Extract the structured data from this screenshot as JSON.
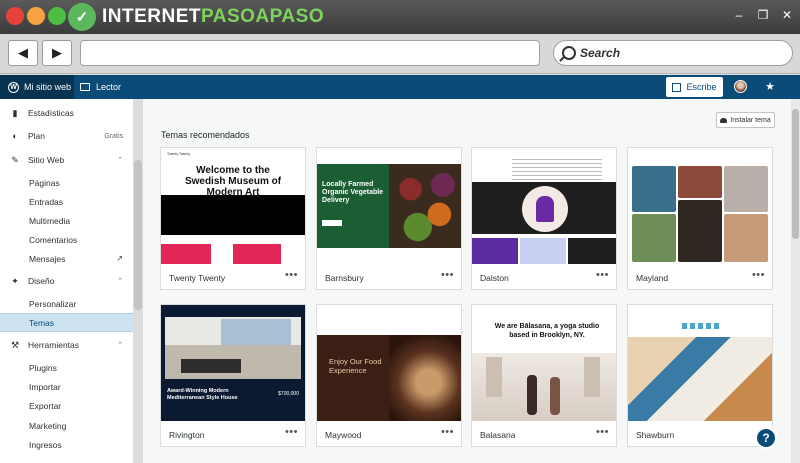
{
  "browser": {
    "logo_text_1": "INTERNET",
    "logo_text_2": "PASOAPASO",
    "search_placeholder": "Search"
  },
  "adminbar": {
    "site_label": "Mi sitio web",
    "reader_label": "Lector",
    "write_label": "Escribe"
  },
  "sidebar": {
    "stats": "Estadísticas",
    "plan": "Plan",
    "plan_badge": "Gratis",
    "site_web": "Sitio Web",
    "pages": "Páginas",
    "posts": "Entradas",
    "media": "Multimedia",
    "comments": "Comentarios",
    "messages": "Mensajes",
    "design": "Diseño",
    "customize": "Personalizar",
    "themes": "Temas",
    "tools": "Herramientas",
    "plugins": "Plugins",
    "import": "Importar",
    "export": "Exportar",
    "marketing": "Marketing",
    "earnings": "Ingresos"
  },
  "main": {
    "section_title": "Temas recomendados",
    "install_label": "Instalar tema",
    "more_label": "•••",
    "themes": [
      {
        "name": "Twenty Twenty",
        "headline": "Welcome to the Swedish Museum of Modern Art"
      },
      {
        "name": "Barnsbury",
        "headline": "Locally Farmed Organic Vegetable Delivery"
      },
      {
        "name": "Dalston"
      },
      {
        "name": "Mayland"
      },
      {
        "name": "Rivington",
        "headline": "Award-Winning Modern Mediterranean Style House",
        "price": "$700,000"
      },
      {
        "name": "Maywood",
        "headline": "Enjoy Our Food Experience"
      },
      {
        "name": "Balasana",
        "headline": "We are Bālasana, a yoga studio based in Brooklyn, NY."
      },
      {
        "name": "Shawburn"
      }
    ]
  },
  "colors": {
    "admin_bar": "#0a4b78",
    "active_item_bg": "#cde3f1",
    "accent_pink": "#e22658"
  }
}
